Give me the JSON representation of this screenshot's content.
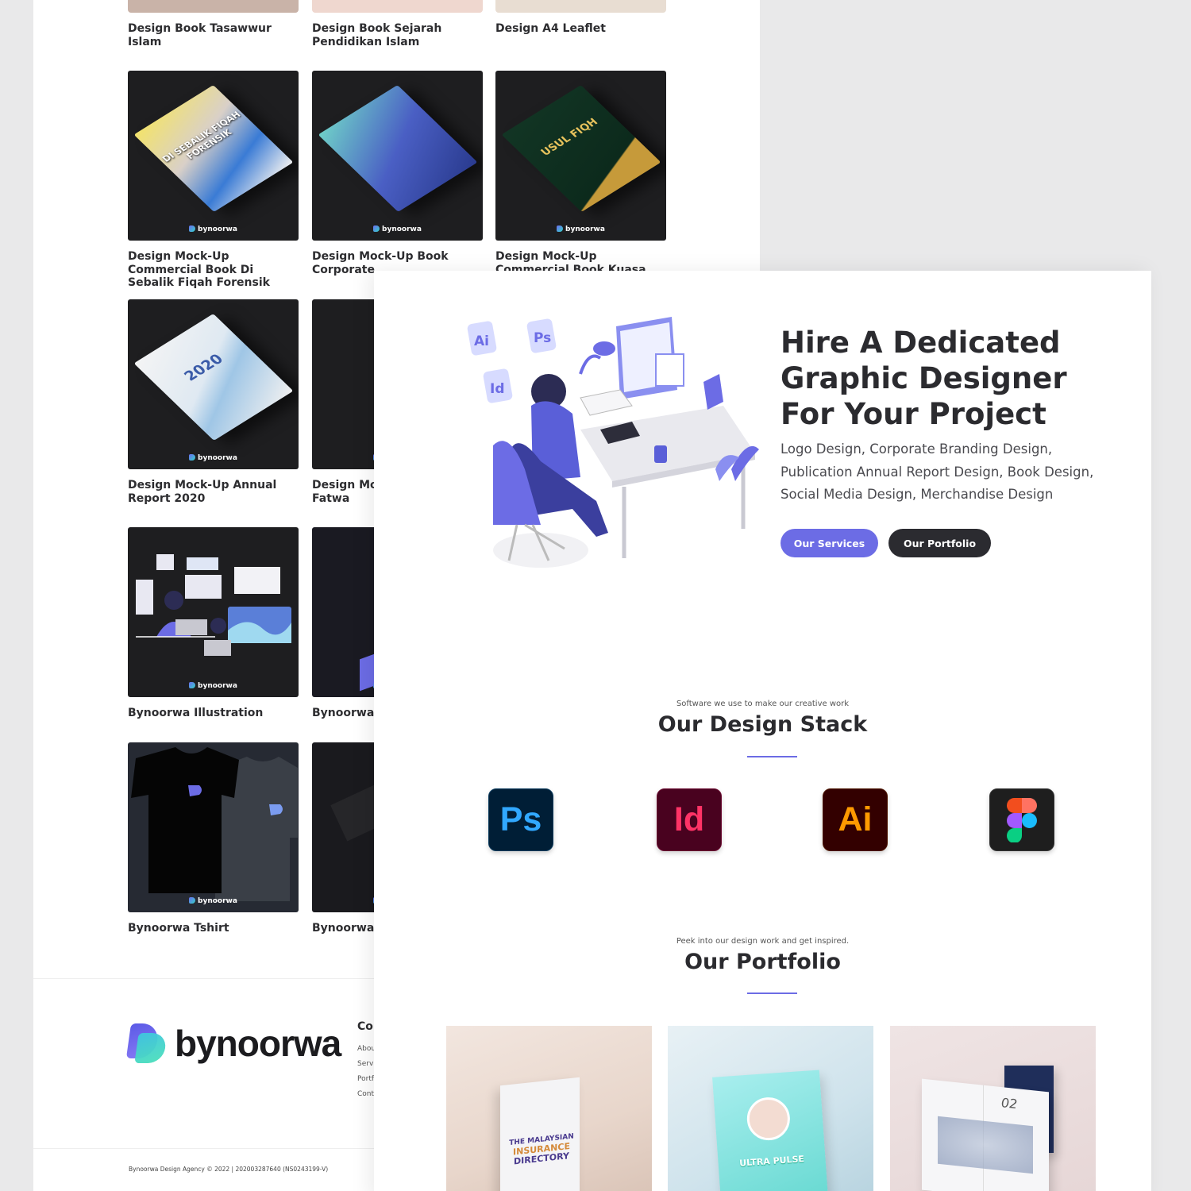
{
  "back_page": {
    "top_row": [
      {
        "caption": "Design Book Tasawwur Islam",
        "color": "#c9b3a8"
      },
      {
        "caption": "Design Book Sejarah Pendidikan Islam",
        "color": "#efd7cf"
      },
      {
        "caption": "Design A4 Leaflet",
        "color": "#e8ddd2"
      }
    ],
    "items": [
      {
        "caption": "Design Mock-Up Commercial Book Di Sebalik Fiqah Forensik",
        "brand": "bynoorwa",
        "book_text": "DI SEBALIK FIQAH FORENSIK"
      },
      {
        "caption": "Design Mock-Up Book Corporate",
        "brand": "bynoorwa"
      },
      {
        "caption": "Design Mock-Up Commercial Book Kuasa Usul Fiqh",
        "brand": "bynoorwa",
        "book_text": "USUL FIQH"
      },
      {
        "caption": "Design Mock-Up Annual Report 2020",
        "brand": "bynoorwa",
        "book_text": "2020"
      },
      {
        "caption": "Design Mock-Up Book Fatwa",
        "brand": "bynoorwa"
      },
      {
        "caption": "Bynoorwa Illustration",
        "brand": "bynoorwa"
      },
      {
        "caption": "Bynoorwa W",
        "brand": "bynoorwa"
      },
      {
        "caption": "Bynoorwa Tshirt",
        "brand": "bynoorwa"
      },
      {
        "caption": "Bynoorwa M",
        "brand": "bynoorwa"
      }
    ],
    "footer": {
      "logo": "bynoorwa",
      "column_heading": "Co",
      "links": [
        "Abou",
        "Servi",
        "Portf",
        "Cont"
      ],
      "copyright": "Bynoorwa Design Agency © 2022 | 202003287640 (NS0243199-V)"
    }
  },
  "front_page": {
    "hero": {
      "title": "Hire A Dedicated Graphic Designer For Your Project",
      "subtitle": "Logo Design, Corporate Branding Design, Publication Annual Report Design, Book Design, Social Media Design, Merchandise Design",
      "btn_services": "Our Services",
      "btn_portfolio": "Our Portfolio",
      "floating_icons": [
        "Ai",
        "Ps",
        "Id"
      ]
    },
    "stack": {
      "subtitle": "Software we use to make our creative work",
      "title": "Our Design Stack",
      "apps": [
        {
          "name": "photoshop-icon",
          "label": "Ps"
        },
        {
          "name": "indesign-icon",
          "label": "Id"
        },
        {
          "name": "illustrator-icon",
          "label": "Ai"
        },
        {
          "name": "figma-icon",
          "label": ""
        }
      ]
    },
    "portfolio": {
      "subtitle": "Peek into our design work and get inspired.",
      "title": "Our Portfolio",
      "items": [
        {
          "lines": [
            "THE MALAYSIAN",
            "INSURANCE",
            "DIRECTORY"
          ]
        },
        {
          "lines": [
            "ULTRA PULSE"
          ]
        },
        {
          "lines": [
            "02"
          ]
        }
      ]
    }
  },
  "colors": {
    "accent": "#6c6ce5",
    "dark": "#2b2b30"
  }
}
